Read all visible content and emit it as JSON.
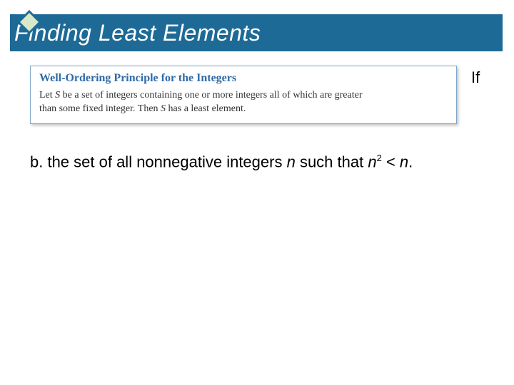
{
  "title": "Finding Least Elements",
  "diamond": {
    "stroke": "#1e6a96",
    "fill": "#d7e9c8"
  },
  "callout": {
    "heading": "Well-Ordering Principle for the Integers",
    "line1_a": "Let ",
    "line1_S": "S",
    "line1_b": " be a set of integers containing one or more integers all of which are greater",
    "line2_a": "than some fixed integer. Then ",
    "line2_S": "S",
    "line2_b": " has a least element."
  },
  "trailing_if": "If",
  "item_b": {
    "prefix": "b. the set of all nonnegative integers ",
    "n1": "n",
    "mid": " such that ",
    "n2": "n",
    "exp": "2",
    "lt": " < ",
    "n3": "n",
    "period": "."
  }
}
